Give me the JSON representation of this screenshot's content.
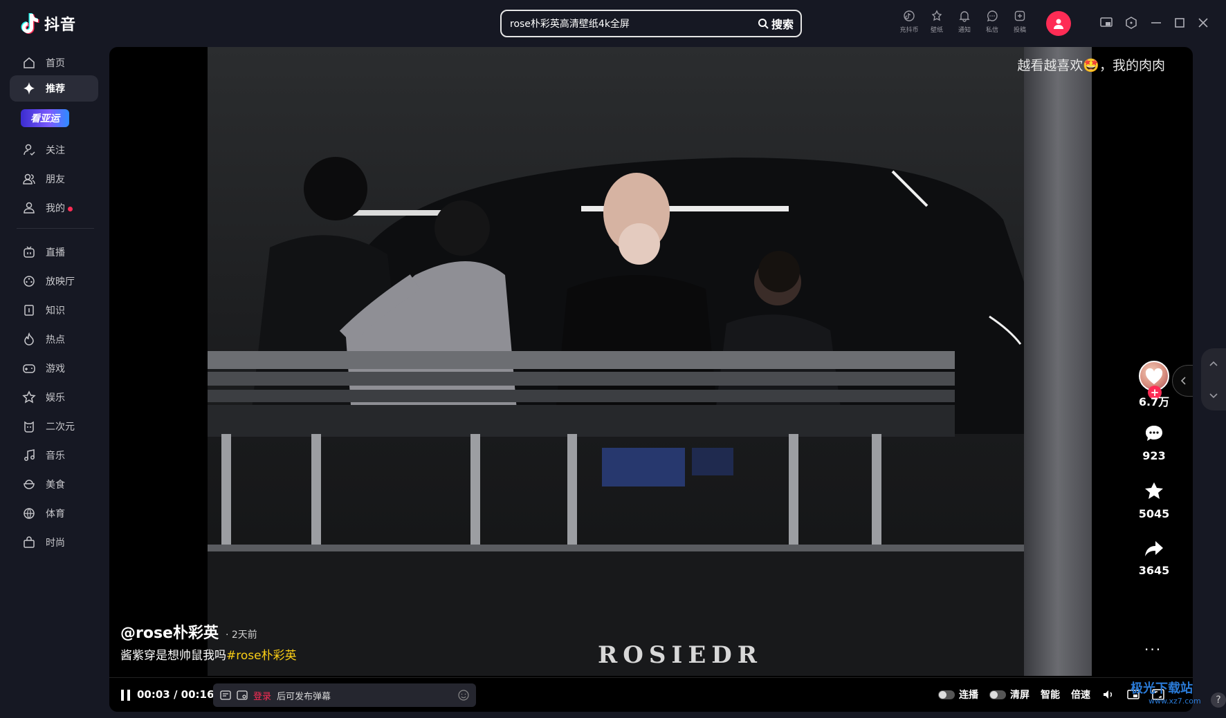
{
  "app": {
    "name": "抖音"
  },
  "search": {
    "query": "rose朴彩英高清壁纸4k全屏",
    "button_label": "搜索"
  },
  "top_tools": [
    {
      "icon": "coin-icon",
      "label": "充抖币"
    },
    {
      "icon": "wallpaper-icon",
      "label": "壁纸"
    },
    {
      "icon": "bell-icon",
      "label": "通知"
    },
    {
      "icon": "message-icon",
      "label": "私信"
    },
    {
      "icon": "upload-icon",
      "label": "投稿"
    }
  ],
  "sidebar": {
    "items": [
      {
        "label": "首页",
        "icon": "home-icon"
      },
      {
        "label": "推荐",
        "icon": "sparkle-icon",
        "active": true
      },
      {
        "label": "关注",
        "icon": "follow-icon"
      },
      {
        "label": "朋友",
        "icon": "friends-icon"
      },
      {
        "label": "我的",
        "icon": "user-icon",
        "dot": true
      },
      {
        "label": "直播",
        "icon": "tv-icon"
      },
      {
        "label": "放映厅",
        "icon": "cinema-icon"
      },
      {
        "label": "知识",
        "icon": "book-icon"
      },
      {
        "label": "热点",
        "icon": "flame-icon"
      },
      {
        "label": "游戏",
        "icon": "gamepad-icon"
      },
      {
        "label": "娱乐",
        "icon": "star-icon"
      },
      {
        "label": "二次元",
        "icon": "anime-icon"
      },
      {
        "label": "音乐",
        "icon": "music-icon"
      },
      {
        "label": "美食",
        "icon": "food-icon"
      },
      {
        "label": "体育",
        "icon": "ball-icon"
      },
      {
        "label": "时尚",
        "icon": "bag-icon"
      }
    ],
    "badge": "看亚运"
  },
  "video": {
    "danmaku": "越看越喜欢🤩，我的肉肉",
    "watermark": "ROSIEDR",
    "author": "@rose朴彩英",
    "posted": "2天前",
    "caption": "酱紫穿是想帅鼠我吗",
    "hashtag": "#rose朴彩英",
    "likes": "6.7万",
    "comments": "923",
    "favorites": "5045",
    "shares": "3645",
    "more": "···"
  },
  "controls": {
    "time": "00:03 / 00:16",
    "login": "登录",
    "danmu_hint": "后可发布弹幕",
    "autoplay": "连播",
    "clear": "清屏",
    "smart": "智能",
    "speed": "倍速"
  },
  "watermark_site": {
    "name": "极光下载站",
    "url": "www.xz7.com"
  },
  "colors": {
    "accent": "#fe2c55",
    "background": "#161823",
    "hashtag": "#face15"
  }
}
